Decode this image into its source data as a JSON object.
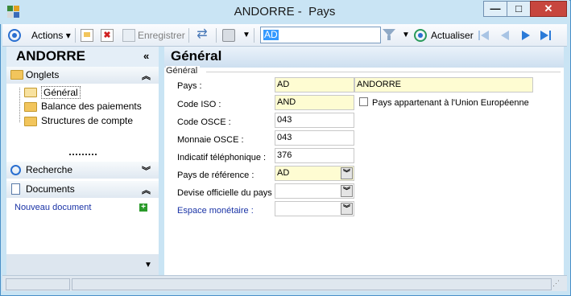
{
  "window": {
    "title": "ANDORRE -  Pays"
  },
  "toolbar": {
    "actions_label": "Actions",
    "save_label": "Enregistrer",
    "search_value": "AD",
    "refresh_label": "Actualiser"
  },
  "left": {
    "title": "ANDORRE",
    "tabs_header": "Onglets",
    "tabs": [
      "Général",
      "Balance des paiements",
      "Structures de compte"
    ],
    "search_header": "Recherche",
    "documents_header": "Documents",
    "new_document_link": "Nouveau document"
  },
  "main": {
    "title": "Général",
    "group_title": "Général",
    "fields": {
      "pays_label": "Pays :",
      "pays_code": "AD",
      "pays_name": "ANDORRE",
      "iso_label": "Code ISO :",
      "iso_value": "AND",
      "osce_label": "Code OSCE :",
      "osce_value": "043",
      "monnaie_label": "Monnaie OSCE :",
      "monnaie_value": "043",
      "tel_label": "Indicatif téléphonique :",
      "tel_value": "376",
      "ref_label": "Pays de référence :",
      "ref_value": "AD",
      "devise_label": "Devise officielle du pays :",
      "devise_value": "",
      "espace_label": "Espace monétaire :",
      "espace_value": ""
    },
    "ue_checkbox_label": "Pays appartenant à l'Union Européenne",
    "ue_checked": false
  },
  "colors": {
    "window_bg": "#c9e4f4",
    "required_field_bg": "#fefcd2",
    "link_color": "#1a33a6",
    "close_button": "#c7463e"
  }
}
